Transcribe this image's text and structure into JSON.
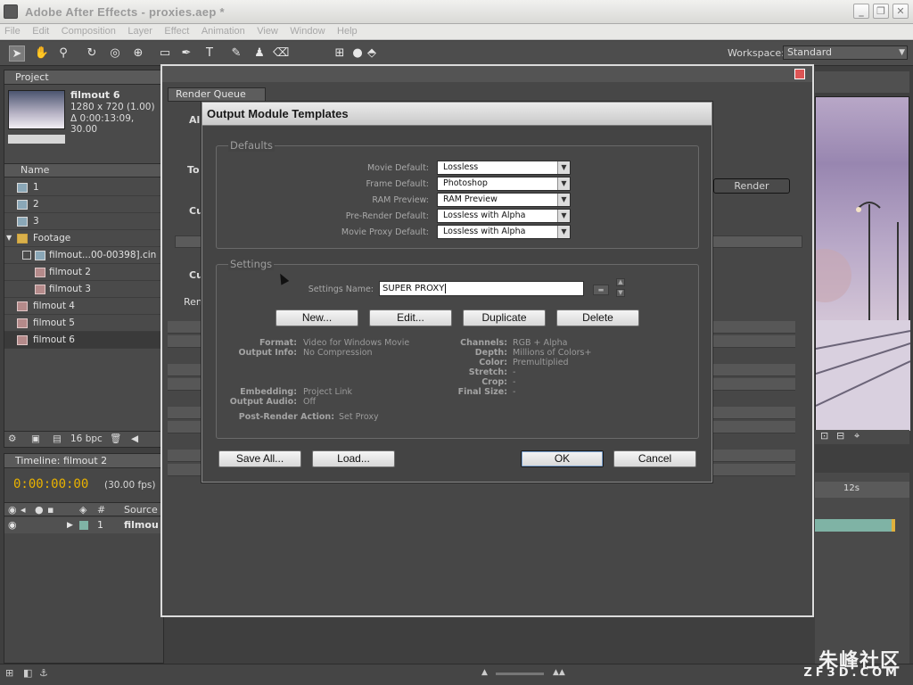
{
  "window": {
    "title": "Adobe After Effects - proxies.aep *",
    "min_glyph": "_",
    "max_glyph": "❐",
    "close_glyph": "✕"
  },
  "menu": [
    "File",
    "Edit",
    "Composition",
    "Layer",
    "Effect",
    "Animation",
    "View",
    "Window",
    "Help"
  ],
  "toolbar": {
    "workspace_label": "Workspace:",
    "workspace_value": "Standard",
    "tool_icons": [
      "selection-tool-icon",
      "hand-tool-icon",
      "zoom-tool-icon",
      "rotate-tool-icon",
      "orbit-camera-icon",
      "pan-behind-icon",
      "rectangle-mask-icon",
      "pen-tool-icon",
      "type-tool-icon",
      "brush-tool-icon",
      "clone-stamp-icon",
      "eraser-tool-icon",
      "axis-mode-icon"
    ]
  },
  "project": {
    "tab_label": "Project",
    "comp_name": "filmout 6",
    "comp_dims": "1280 x 720 (1.00)",
    "comp_duration": "Δ 0:00:13:09, 30.00",
    "name_header": "Name",
    "items": [
      {
        "label": "1",
        "type": "comp"
      },
      {
        "label": "2",
        "type": "comp"
      },
      {
        "label": "3",
        "type": "comp"
      },
      {
        "label": "Footage",
        "type": "folder"
      },
      {
        "label": "filmout...00-00398].cin",
        "type": "footage"
      },
      {
        "label": "filmout 2",
        "type": "film"
      },
      {
        "label": "filmout 3",
        "type": "film"
      },
      {
        "label": "filmout 4",
        "type": "film"
      },
      {
        "label": "filmout 5",
        "type": "film"
      },
      {
        "label": "filmout 6",
        "type": "film"
      }
    ],
    "bpc": "16 bpc"
  },
  "timeline": {
    "tab_label": "Timeline: filmout 2",
    "timecode": "0:00:00:00",
    "fps": "(30.00 fps)",
    "source_header": "Source N",
    "layer_index": "1",
    "layer_name": "filmou",
    "ruler_label": "12s"
  },
  "render_queue": {
    "tab_label": "Render Queue",
    "render_label": "Render",
    "col_all": "All",
    "col_to": "To",
    "col_cu": "Cu",
    "col_ren": "Ren"
  },
  "dialog": {
    "title": "Output Module Templates",
    "defaults_label": "Defaults",
    "defaults": [
      {
        "label": "Movie Default:",
        "value": "Lossless"
      },
      {
        "label": "Frame Default:",
        "value": "Photoshop"
      },
      {
        "label": "RAM Preview:",
        "value": "RAM Preview"
      },
      {
        "label": "Pre-Render Default:",
        "value": "Lossless with Alpha"
      },
      {
        "label": "Movie Proxy Default:",
        "value": "Lossless with Alpha"
      }
    ],
    "settings_label": "Settings",
    "settings_name_label": "Settings Name:",
    "settings_name_value": "SUPER PROXY",
    "buttons": {
      "new": "New...",
      "edit": "Edit...",
      "duplicate": "Duplicate",
      "delete": "Delete",
      "save_all": "Save All...",
      "load": "Load...",
      "ok": "OK",
      "cancel": "Cancel"
    },
    "info_left": [
      {
        "label": "Format:",
        "value": "Video for Windows Movie"
      },
      {
        "label": "Output Info:",
        "value": "No Compression"
      },
      {
        "label": "Embedding:",
        "value": "Project Link"
      },
      {
        "label": "Output Audio:",
        "value": "Off"
      },
      {
        "label": "Post-Render Action:",
        "value": "Set Proxy"
      }
    ],
    "info_right": [
      {
        "label": "Channels:",
        "value": "RGB + Alpha"
      },
      {
        "label": "Depth:",
        "value": "Millions of Colors+"
      },
      {
        "label": "Color:",
        "value": "Premultiplied"
      },
      {
        "label": "Stretch:",
        "value": "-"
      },
      {
        "label": "Crop:",
        "value": "-"
      },
      {
        "label": "Final Size:",
        "value": "-"
      }
    ]
  },
  "watermark": {
    "brand": "朱峰社区",
    "url": "ZF3D.COM"
  }
}
